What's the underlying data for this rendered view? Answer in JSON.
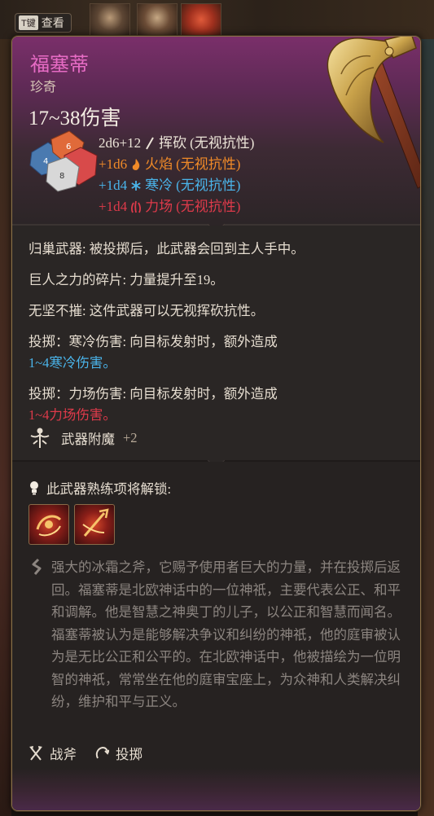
{
  "top_bar": {
    "key_label": "T键",
    "inspect_label": "查看"
  },
  "item": {
    "name": "福塞蒂",
    "rarity": "珍奇",
    "damage": "17~38伤害",
    "damage_lines": [
      {
        "amount": "2d6+12",
        "type": "挥砍",
        "note": "(无视抗性)",
        "color": "#ece4d8",
        "icon": "slash-icon"
      },
      {
        "amount": "+1d6",
        "type": "火焰",
        "note": "(无视抗性)",
        "color": "#f08a28",
        "icon": "fire-icon"
      },
      {
        "amount": "+1d4",
        "type": "寒冷",
        "note": "(无视抗性)",
        "color": "#4ab4ea",
        "icon": "snowflake-icon"
      },
      {
        "amount": "+1d4",
        "type": "力场",
        "note": "(无视抗性)",
        "color": "#de3a4a",
        "icon": "force-icon"
      }
    ],
    "properties": [
      {
        "text": "归巢武器: 被投掷后，此武器会回到主人手中。"
      },
      {
        "text": "巨人之力的碎片: 力量提升至19。"
      },
      {
        "text": "无坚不摧: 这件武器可以无视挥砍抗性。"
      },
      {
        "text": "投掷：寒冷伤害: 向目标发射时，额外造成",
        "extra": "1~4寒冷伤害。",
        "extra_color": "blue"
      },
      {
        "text": "投掷：力场伤害: 向目标发射时，额外造成",
        "extra": "1~4力场伤害。",
        "extra_color": "red"
      }
    ],
    "enchantment": {
      "label": "武器附魔",
      "value": "+2"
    },
    "proficiency_unlock": "此武器熟练项将解锁:",
    "description": "强大的冰霜之斧，它赐予使用者巨大的力量，并在投掷后返回。福塞蒂是北欧神话中的一位神祇，主要代表公正、和平和调解。他是智慧之神奥丁的儿子，以公正和智慧而闻名。福塞蒂被认为是能够解决争议和纠纷的神祇，他的庭审被认为是无比公正和公平的。在北欧神话中，他被描绘为一位明智的神祇，常常坐在他的庭审宝座上，为众神和人类解决纠纷，维护和平与正义。",
    "tags": [
      {
        "label": "战斧",
        "icon": "crossed-axes-icon"
      },
      {
        "label": "投掷",
        "icon": "throw-icon"
      }
    ]
  },
  "colors": {
    "name": "#e66bc4",
    "fire": "#f08a28",
    "cold": "#4ab4ea",
    "force": "#de3a4a",
    "description": "#8c8580"
  }
}
